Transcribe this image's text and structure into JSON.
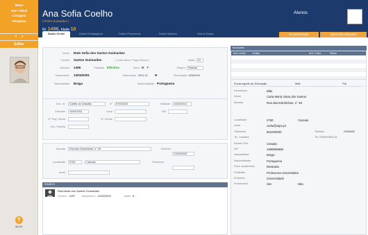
{
  "sidebar": {
    "menu": [
      "Menu",
      "Ano / Nivel",
      "Listagem",
      "Pesquisa"
    ],
    "nav_prev": "«",
    "nav_next": "»",
    "editar": "Editar",
    "help": "Ajuda"
  },
  "header": {
    "name": "Ana Sofia Coelho",
    "subtitle": "( Prefer Guimarães )",
    "n_label": "Nr.",
    "n_value": "1496,",
    "idade_label": "Idade",
    "idade_value": "10",
    "section": "Alunos"
  },
  "tabs": [
    "Dados Gerais",
    "Dados Pedagógicos",
    "Dados Financeiros",
    "Dados Médicos",
    "Outros Dados"
  ],
  "buttons": {
    "documentacao": "Documentação",
    "impressao": "Impressão Etiquetas"
  },
  "personal": {
    "nome_label": "Nome",
    "nome": "Rute Sofia dos Santos Guimarães",
    "familia_label": "Família",
    "familia": "Santos Guimarães",
    "familia_hint": "( Conta Mesm / Pagar Mensal )",
    "genero_label": "Idade",
    "genero": "10",
    "numero_label": "Número",
    "numero": "1496",
    "situacao_label": "Situação",
    "situacao": "Efectivo",
    "sexo_label": "Sexo",
    "sexo_m": "M",
    "sexo_f": "F",
    "origem_label": "Origem",
    "origem": "Particular",
    "nasc_label": "Nascimento",
    "nasc": "14/04/2001",
    "matric_label": "Matriculado",
    "matric": "2011-12",
    "matric_flag": "N",
    "renov_label": "Renovação",
    "renov": "2009/2010",
    "natural_label": "Naturalidade",
    "natural": "Braga",
    "nacional_label": "Nacionalidade",
    "nacional": "Portuguesa"
  },
  "docs": {
    "doc_label": "Doc. Id.",
    "doc": "Cartão do Cidadão",
    "docnum": "87001630",
    "validade_label": "Validade",
    "validade": "14/04/2014",
    "emissao_label": "Emissão",
    "emissao": "14/04/2011",
    "local_label": "Local",
    "nif_label": "NIF",
    "seg_label": "N° Seg. Social",
    "utente_label": "N° Utente",
    "abono_label": "Esc. Família"
  },
  "address": {
    "morada_label": "Morada",
    "morada": "Rua das Estrelinhas, n° 28",
    "telefone_label": "Telefone",
    "telefone": "2100000000",
    "local_label": "Localidade",
    "cp": "3750",
    "localidade": "Cascais",
    "telemovel_label": "Telemóvel",
    "email_label": "email"
  },
  "irmaos": {
    "title": "IRMÃOS",
    "name": "Rita Maria dos Santos Guimarães",
    "numero_label": "Número",
    "numero": "1497",
    "nasc_label": "Nascimento",
    "nasc": "14/04/2003",
    "idade_label": "Idade",
    "idade": "8"
  },
  "inscricoes": {
    "title": "Inscrições",
    "cols": [
      "Ano Lectivo",
      "Código",
      "Ano / Letra",
      "Status"
    ]
  },
  "guardian": {
    "tabs": [
      "Encarregado de Educação",
      "Mãe",
      "Pai"
    ],
    "rows": [
      {
        "l": "Parentesco",
        "v": "Mãe"
      },
      {
        "l": "Nome",
        "v": "Carla Maria Viana dos Santos"
      },
      {
        "l": "Morada",
        "v": "Rua das Estrelinhas, n° 28"
      },
      {
        "l": "",
        "v": ""
      },
      {
        "l": "",
        "v": ""
      },
      {
        "l": "Localidade",
        "v": "2750",
        "v2": "Cascais"
      },
      {
        "l": "email",
        "v": "carla@sapo.pt"
      },
      {
        "l": "Telemóvel",
        "v": "961000000",
        "l3": "Telefone",
        "v3": "21000000"
      },
      {
        "l": "Tel. Trabalho",
        "v": "",
        "l3": "Tel. EMERGÊNCIA",
        "v3": ""
      },
      {
        "l": "Estado Civil",
        "v": "Casada"
      },
      {
        "l": "NIF",
        "v": "1999999999"
      },
      {
        "l": "Naturalidade",
        "v": "Braga"
      },
      {
        "l": "Nacionalidade",
        "v": "Portuguesa"
      },
      {
        "l": "Form. Académica",
        "v": "Mestrado"
      },
      {
        "l": "Profissão",
        "v": "Professora Universitária"
      },
      {
        "l": "Empresa",
        "v": "Universidade"
      },
      {
        "l": "Funcionário",
        "v": "Sim",
        "v2": "Não"
      }
    ]
  }
}
